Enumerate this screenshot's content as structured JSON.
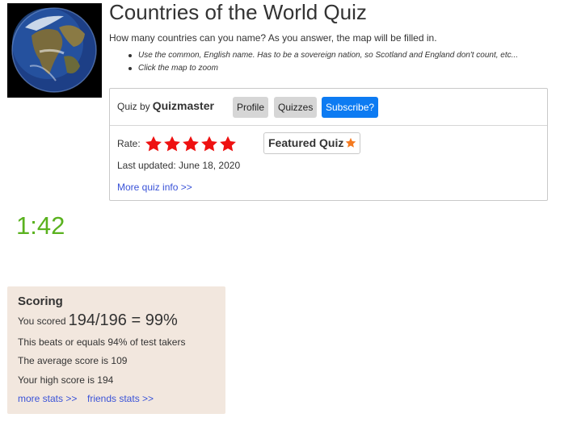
{
  "quiz": {
    "title": "Countries of the World Quiz",
    "subtitle": "How many countries can you name? As you answer, the map will be filled in.",
    "bullets": [
      "Use the common, English name. Has to be a sovereign nation, so Scotland and England don't count, etc...",
      "Click the map to zoom"
    ]
  },
  "info": {
    "quiz_by_label": "Quiz by",
    "author": "Quizmaster",
    "buttons": {
      "profile": "Profile",
      "quizzes": "Quizzes",
      "subscribe": "Subscribe?"
    },
    "rate_label": "Rate:",
    "star_count": 5,
    "star_color": "#ee1111",
    "featured_label": "Featured Quiz",
    "featured_star_color": "#f47a20",
    "last_updated": "Last updated: June 18, 2020",
    "more_info": "More quiz info >>"
  },
  "timer": "1:42",
  "scoring": {
    "heading": "Scoring",
    "scored_label": "You scored",
    "score": "194/196 = 99%",
    "beats": "This beats or equals 94% of test takers",
    "average": "The average score is 109",
    "high": "Your high score is 194",
    "more_stats": "more stats >>",
    "friends_stats": "friends stats >>"
  },
  "colors": {
    "timer": "#5ab21f",
    "link": "#3a53d8",
    "subscribe_bg": "#0d7bf2",
    "scoring_bg": "#f2e7de"
  }
}
